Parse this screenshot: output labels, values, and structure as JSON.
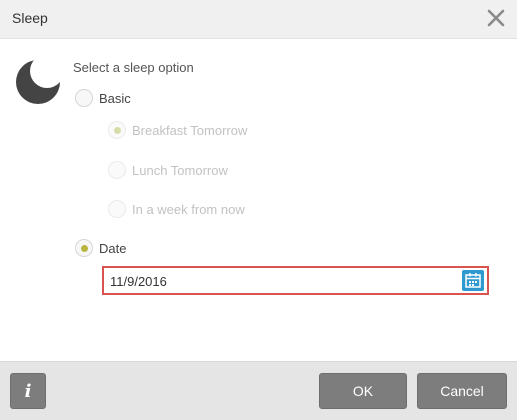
{
  "dialog": {
    "title": "Sleep",
    "close_icon": "close-icon"
  },
  "body": {
    "icon": "moon-icon",
    "prompt": "Select a sleep option",
    "options": {
      "basic": {
        "label": "Basic",
        "selected": false,
        "enabled": true
      },
      "breakfast": {
        "label": "Breakfast Tomorrow",
        "selected": true,
        "enabled": false
      },
      "lunch": {
        "label": "Lunch Tomorrow",
        "selected": false,
        "enabled": false
      },
      "week": {
        "label": "In a week from now",
        "selected": false,
        "enabled": false
      },
      "date": {
        "label": "Date",
        "selected": true,
        "enabled": true
      }
    },
    "date_field": {
      "value": "11/9/2016",
      "icon": "calendar-icon"
    }
  },
  "footer": {
    "info_label": "i",
    "ok_label": "OK",
    "cancel_label": "Cancel"
  },
  "colors": {
    "accent_radio": "#b8b63c",
    "highlight_border": "#d9534f",
    "calendar_button": "#2e9ad0",
    "button_gray": "#7d7d7d"
  }
}
